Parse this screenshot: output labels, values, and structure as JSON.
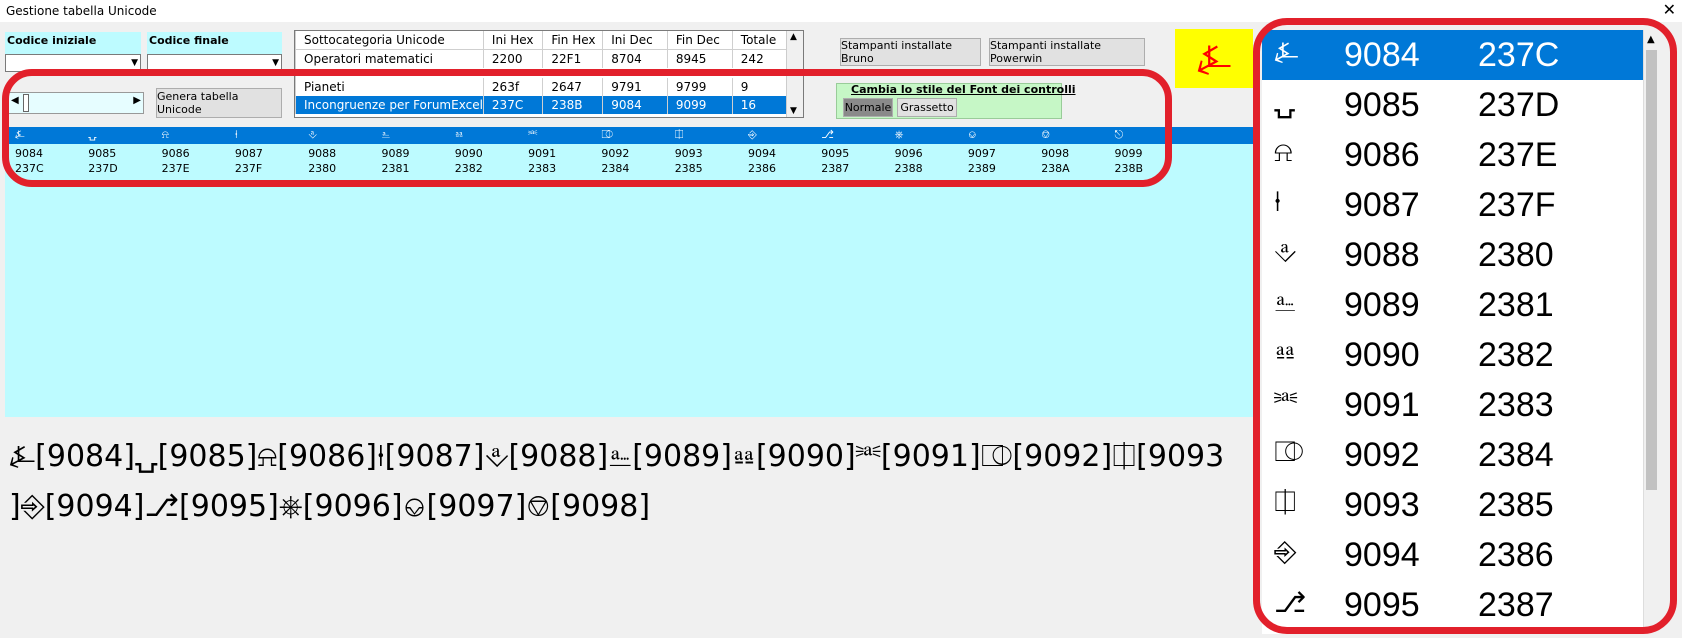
{
  "window": {
    "title": "Gestione tabella Unicode",
    "close_glyph": "✕"
  },
  "codes": {
    "start_label": "Codice iniziale",
    "end_label": "Codice finale"
  },
  "generate_button": "Genera tabella Unicode",
  "categories": {
    "headers": [
      "Sottocategoria Unicode",
      "Ini Hex",
      "Fin Hex",
      "Ini Dec",
      "Fin Dec",
      "Totale"
    ],
    "rows": [
      [
        "Operatori matematici",
        "2200",
        "22F1",
        "8704",
        "8945",
        "242"
      ],
      [
        "Pianeti",
        "263f",
        "2647",
        "9791",
        "9799",
        "9"
      ],
      [
        "Incongruenze per ForumExcel",
        "237C",
        "238B",
        "9084",
        "9099",
        "16"
      ]
    ],
    "selected_index": 2
  },
  "printer_buttons": {
    "bruno": "Stampanti installate Bruno",
    "powerwin": "Stampanti installate Powerwin"
  },
  "font_style": {
    "title": "Cambia lo stile del Font dei controlli",
    "normal": "Normale",
    "bold": "Grassetto"
  },
  "preview_symbol": "⍼",
  "strip": {
    "symbols": [
      "⍼",
      "⍽",
      "⍾",
      "⍿",
      "⎀",
      "⎁",
      "⎂",
      "⎃",
      "⎄",
      "⎅",
      "⎆",
      "⎇",
      "⎈",
      "⎉",
      "⎊",
      "⎋"
    ],
    "dec": [
      "9084",
      "9085",
      "9086",
      "9087",
      "9088",
      "9089",
      "9090",
      "9091",
      "9092",
      "9093",
      "9094",
      "9095",
      "9096",
      "9097",
      "9098",
      "9099"
    ],
    "hex": [
      "237C",
      "237D",
      "237E",
      "237F",
      "2380",
      "2381",
      "2382",
      "2383",
      "2384",
      "2385",
      "2386",
      "2387",
      "2388",
      "2389",
      "238A",
      "238B"
    ]
  },
  "text_line1": "⍼[9084]⍽[9085]⍾[9086]⍿[9087]⎀[9088]⎁[9089]⎂[9090]⎃[9091]⎄[9092]⎅[9093",
  "text_line2": "]⎆[9094]⎇[9095]⎈[9096]⎉[9097]⎊[9098]",
  "list": {
    "rows": [
      {
        "symbol": "⍼",
        "dec": "9084",
        "hex": "237C"
      },
      {
        "symbol": "⍽",
        "dec": "9085",
        "hex": "237D"
      },
      {
        "symbol": "⍾",
        "dec": "9086",
        "hex": "237E"
      },
      {
        "symbol": "⍿",
        "dec": "9087",
        "hex": "237F"
      },
      {
        "symbol": "⎀",
        "dec": "9088",
        "hex": "2380"
      },
      {
        "symbol": "⎁",
        "dec": "9089",
        "hex": "2381"
      },
      {
        "symbol": "⎂",
        "dec": "9090",
        "hex": "2382"
      },
      {
        "symbol": "⎃",
        "dec": "9091",
        "hex": "2383"
      },
      {
        "symbol": "⎄",
        "dec": "9092",
        "hex": "2384"
      },
      {
        "symbol": "⎅",
        "dec": "9093",
        "hex": "2385"
      },
      {
        "symbol": "⎆",
        "dec": "9094",
        "hex": "2386"
      },
      {
        "symbol": "⎇",
        "dec": "9095",
        "hex": "2387"
      }
    ],
    "selected_index": 0
  },
  "colors": {
    "accent": "#0078d7",
    "cyan": "#bdfbff",
    "highlight_red": "#e2202b",
    "preview_bg": "#ffff00",
    "preview_fg": "#ff0000",
    "font_group_bg": "#c6f7c6"
  }
}
